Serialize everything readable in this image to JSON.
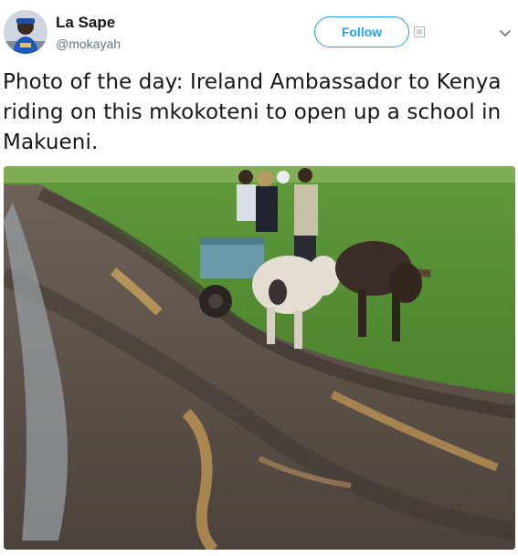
{
  "tweet": {
    "display_name": "La Sape",
    "handle": "@mokayah",
    "follow_label": "Follow",
    "text": "Photo of the day: Ireland Ambassador to Kenya riding on this mkokoteni to open up a school in Makueni.",
    "icons": {
      "avatar": "user-avatar",
      "brand": "twitter-bird-icon",
      "menu": "chevron-down-icon"
    }
  },
  "colors": {
    "accent": "#1da1f2",
    "text": "#14171a",
    "secondary": "#657786"
  }
}
